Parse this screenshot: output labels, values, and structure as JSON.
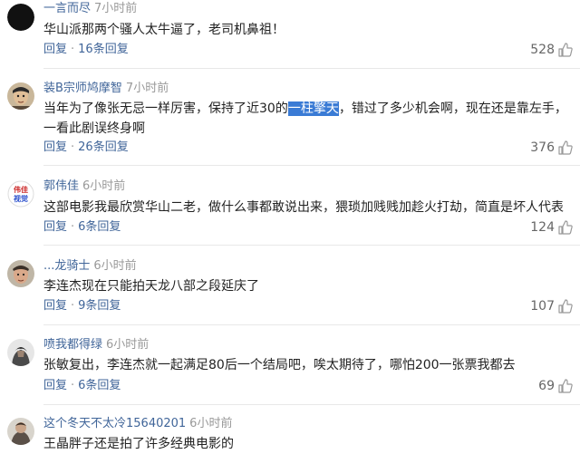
{
  "comments": [
    {
      "username": "一言而尽",
      "time": "7小时前",
      "text_before": "华山派那两个骚人太牛逼了，老司机鼻祖！",
      "highlight": "",
      "text_after": "",
      "reply_label": "回复",
      "reply_count": "16条回复",
      "likes": "528"
    },
    {
      "username": "装B宗师鸠摩智",
      "time": "7小时前",
      "text_before": "当年为了像张无忌一样厉害，保持了近30的",
      "highlight": "一柱擎天",
      "text_after": "，错过了多少机会啊，现在还是靠左手，一看此剧误终身啊",
      "reply_label": "回复",
      "reply_count": "26条回复",
      "likes": "376"
    },
    {
      "username": "郭伟佳",
      "time": "6小时前",
      "text_before": "这部电影我最欣赏华山二老，做什么事都敢说出来，猥琐加贱贱加趁火打劫，简直是坏人代表",
      "highlight": "",
      "text_after": "",
      "reply_label": "回复",
      "reply_count": "6条回复",
      "likes": "124"
    },
    {
      "username": "...龙骑士",
      "time": "6小时前",
      "text_before": "李连杰现在只能拍天龙八部之段延庆了",
      "highlight": "",
      "text_after": "",
      "reply_label": "回复",
      "reply_count": "9条回复",
      "likes": "107"
    },
    {
      "username": "喷我都得绿",
      "time": "6小时前",
      "text_before": "张敏复出，李连杰就一起满足80后一个结局吧，唉太期待了，哪怕200一张票我都去",
      "highlight": "",
      "text_after": "",
      "reply_label": "回复",
      "reply_count": "6条回复",
      "likes": "69"
    },
    {
      "username": "这个冬天不太冷15640201",
      "time": "6小时前",
      "text_before": "王晶胖子还是拍了许多经典电影的",
      "highlight": "",
      "text_after": "",
      "reply_label": "",
      "reply_count": "",
      "likes": ""
    }
  ],
  "avatar_text": {
    "c3_line1": "伟佳",
    "c3_line2": "视觉"
  },
  "icons": {
    "like": "thumbs-up-icon"
  },
  "colors": {
    "username": "#406599",
    "time": "#999999",
    "highlight": "#3a7bd5"
  }
}
